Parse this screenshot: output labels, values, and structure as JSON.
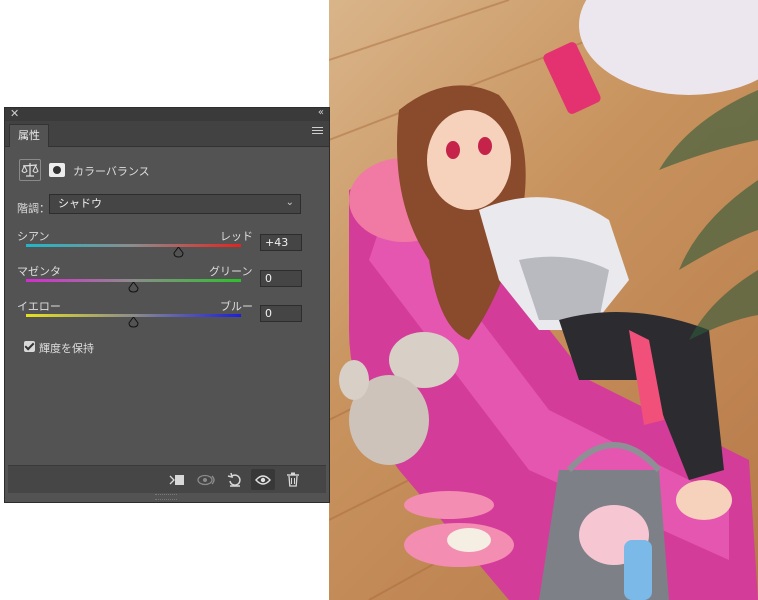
{
  "panel": {
    "tab_label": "属性",
    "header_title": "カラーバランス",
    "tone_label": "階調：",
    "tone_value": "シャドウ",
    "sliders": [
      {
        "left": "シアン",
        "right": "レッド",
        "value": "+43",
        "level": 43
      },
      {
        "left": "マゼンタ",
        "right": "グリーン",
        "value": "0",
        "level": 0
      },
      {
        "left": "イエロー",
        "right": "ブルー",
        "value": "0",
        "level": 0
      }
    ],
    "preserve_luminosity": "輝度を保持",
    "preserve_checked": true
  },
  "colors": {
    "panel_bg": "#535353",
    "cyan": "#1fb7c9",
    "red": "#e3241f",
    "magenta": "#d52bd1",
    "green": "#2cc12a",
    "yellow": "#e6e21e",
    "blue": "#1e1fd9"
  },
  "icons": {
    "close": "close-icon",
    "collapse": "double-chevron-icon",
    "menu": "panel-menu-icon",
    "adjustment": "balance-scale-icon",
    "mask": "mask-icon",
    "footer": [
      "clip-to-layer-icon",
      "view-previous-state-icon",
      "reset-icon",
      "visibility-eye-icon",
      "trash-icon"
    ]
  }
}
